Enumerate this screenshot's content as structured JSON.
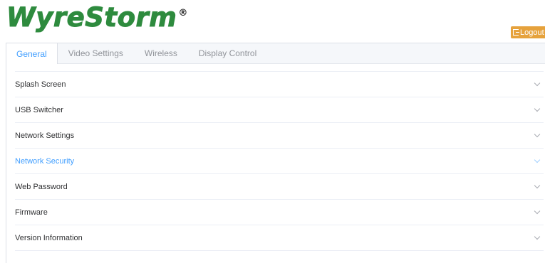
{
  "brand": {
    "logo_text": "WyreStorm",
    "registered_mark": "®"
  },
  "header": {
    "logout_label": "Logout"
  },
  "tabs": [
    {
      "label": "General",
      "active": true
    },
    {
      "label": "Video Settings",
      "active": false
    },
    {
      "label": "Wireless",
      "active": false
    },
    {
      "label": "Display Control",
      "active": false
    }
  ],
  "sections": [
    {
      "label": "Splash Screen"
    },
    {
      "label": "USB Switcher"
    },
    {
      "label": "Network Settings"
    },
    {
      "label": "Network Security",
      "highlighted": true
    },
    {
      "label": "Web Password"
    },
    {
      "label": "Firmware"
    },
    {
      "label": "Version Information"
    }
  ],
  "colors": {
    "brand_green": "#2e8b3e",
    "logout_orange": "#e6a23c",
    "accent_blue": "#409eff"
  }
}
